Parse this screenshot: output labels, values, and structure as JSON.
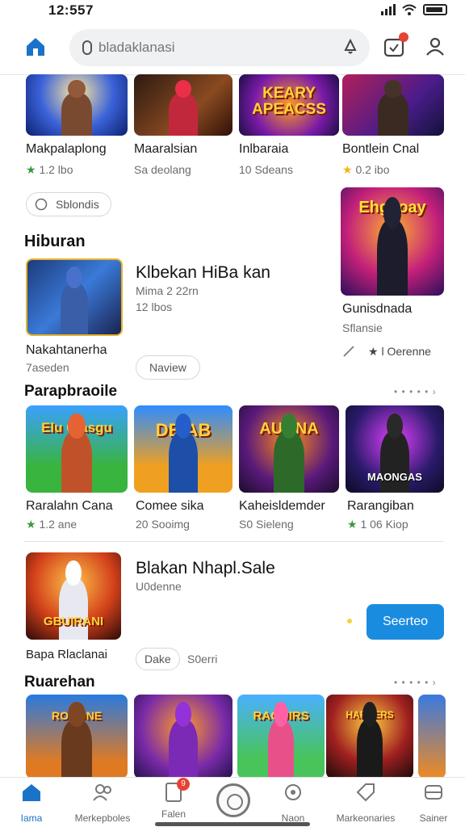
{
  "status_bar": {
    "time": "12:557"
  },
  "search": {
    "placeholder": "bladaklanasi"
  },
  "row1": [
    {
      "name": "Makpalaplong",
      "meta": "1.2 lbo",
      "star": "★"
    },
    {
      "name": "Maaralsian",
      "meta": "Sa deolang"
    },
    {
      "name": "Inlbaraia",
      "meta": "10 Sdeans"
    },
    {
      "name": "Bontlein Cnal",
      "meta": "0.2 ibo",
      "star": "★"
    }
  ],
  "row1_banner": "KEARY APEACSS",
  "chip_1": "Sblondis",
  "side_card": {
    "banner": "Ehgaoay",
    "name": "Gunisdnada",
    "meta": "Sflansie",
    "rating": "★ l Oerenne"
  },
  "section_hiburan": {
    "title": "Hiburan"
  },
  "featured_1": {
    "title": "Klbekan HiBa kan",
    "line1": "Mima 2 22rn",
    "line2": "12 lbos",
    "name": "Nakahtanerha",
    "meta": "7aseden",
    "chip": "Naview"
  },
  "section_parapbraoile": {
    "title": "Parapbraoile",
    "more": "• • • • • ›"
  },
  "row2": [
    {
      "name": "Raralahn Cana",
      "meta": "1.2 ane",
      "star": "★",
      "banner": "Elu Ciasgu"
    },
    {
      "name": "Comee sika",
      "meta": "20 Sooimg",
      "banner": "DEIAB"
    },
    {
      "name": "Kaheisldemder",
      "meta": "S0 Sieleng",
      "banner": "AUGNA"
    },
    {
      "name": "Rarangiban",
      "meta": "1 06 Kiop",
      "star": "★",
      "banner": "MAONGAS"
    }
  ],
  "featured_2": {
    "title": "Blakan Nhapl.Sale",
    "sub": "U0denne",
    "name": "Bapa Rlaclanai",
    "chip": "Dake",
    "chip_text": "S0erri",
    "cta": "Seerteo",
    "banner": "GBUIRANI"
  },
  "section_ruarehan": {
    "title": "Ruarehan",
    "more": "• • • • • ›"
  },
  "row3_banners": [
    "ROGONE",
    "",
    "RAOUIRS",
    "HARBERS",
    ""
  ],
  "bottom_nav": [
    {
      "label": "Iama"
    },
    {
      "label": "Merkepboles"
    },
    {
      "label": "Falen",
      "badge": "9"
    },
    {
      "label": "Naon"
    },
    {
      "label": "Markeonaries"
    },
    {
      "label": "Sainer"
    }
  ],
  "colors": {
    "accent": "#1a8ce0",
    "nav_active": "#1a73c8",
    "badge": "#e84234"
  }
}
